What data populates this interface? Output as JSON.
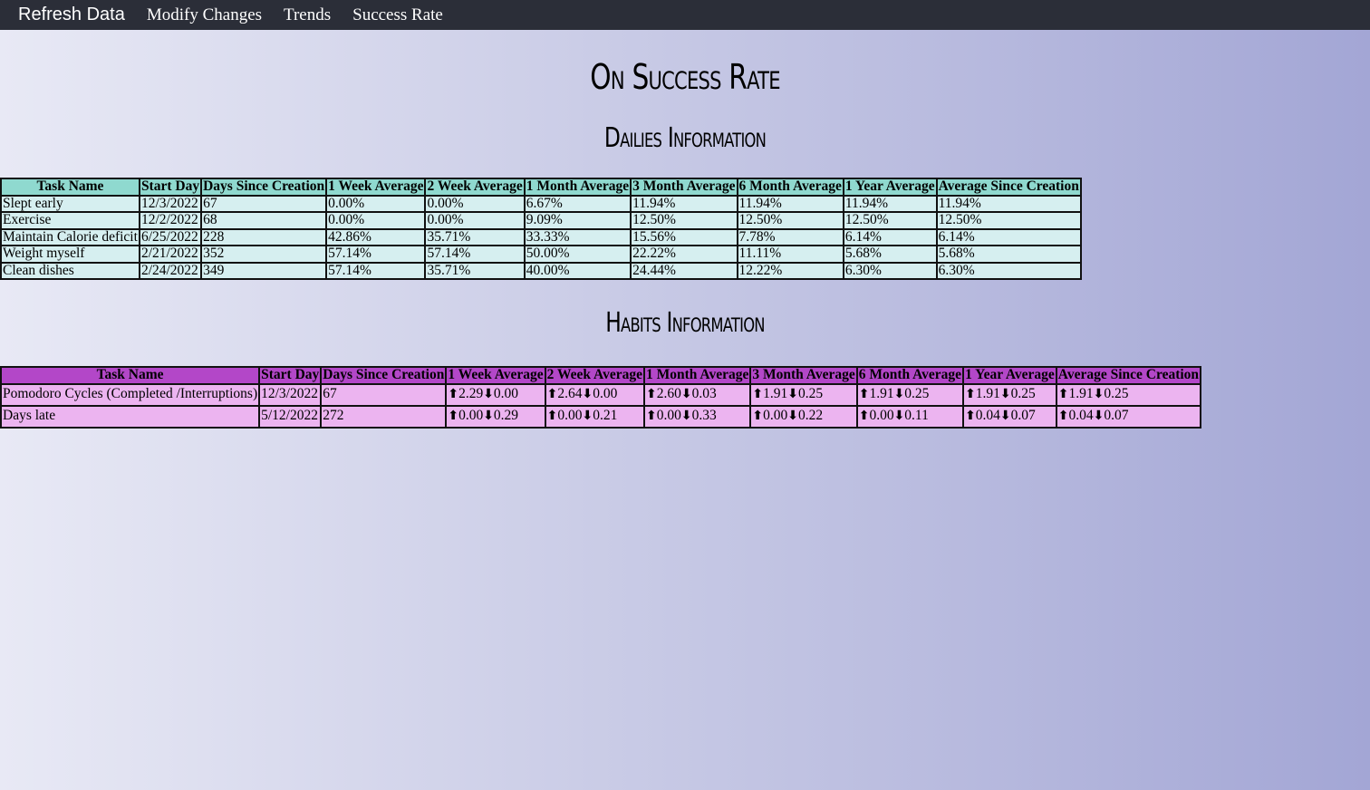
{
  "nav": {
    "brand": "Refresh Data",
    "links": [
      "Modify Changes",
      "Trends",
      "Success Rate"
    ]
  },
  "page_title": "On Success Rate",
  "dailies": {
    "title": "Dailies Information",
    "headers": [
      "Task Name",
      "Start Day",
      "Days Since Creation",
      "1 Week Average",
      "2 Week Average",
      "1 Month Average",
      "3 Month Average",
      "6 Month Average",
      "1 Year Average",
      "Average Since Creation"
    ],
    "rows": [
      [
        "Slept early",
        "12/3/2022",
        "67",
        "0.00%",
        "0.00%",
        "6.67%",
        "11.94%",
        "11.94%",
        "11.94%",
        "11.94%"
      ],
      [
        "Exercise",
        "12/2/2022",
        "68",
        "0.00%",
        "0.00%",
        "9.09%",
        "12.50%",
        "12.50%",
        "12.50%",
        "12.50%"
      ],
      [
        "Maintain Calorie deficit",
        "6/25/2022",
        "228",
        "42.86%",
        "35.71%",
        "33.33%",
        "15.56%",
        "7.78%",
        "6.14%",
        "6.14%"
      ],
      [
        "Weight myself",
        "2/21/2022",
        "352",
        "57.14%",
        "57.14%",
        "50.00%",
        "22.22%",
        "11.11%",
        "5.68%",
        "5.68%"
      ],
      [
        "Clean dishes",
        "2/24/2022",
        "349",
        "57.14%",
        "35.71%",
        "40.00%",
        "24.44%",
        "12.22%",
        "6.30%",
        "6.30%"
      ]
    ]
  },
  "habits": {
    "title": "Habits Information",
    "up_icon": "arrow-up-icon",
    "down_icon": "arrow-down-icon",
    "headers": [
      "Task Name",
      "Start Day",
      "Days Since Creation",
      "1 Week Average",
      "2 Week Average",
      "1 Month Average",
      "3 Month Average",
      "6 Month Average",
      "1 Year Average",
      "Average Since Creation"
    ],
    "rows": [
      {
        "name": "Pomodoro Cycles (Completed /Interruptions)",
        "start": "12/3/2022",
        "days": "67",
        "averages": [
          {
            "up": "2.29",
            "down": "0.00"
          },
          {
            "up": "2.64",
            "down": "0.00"
          },
          {
            "up": "2.60",
            "down": "0.03"
          },
          {
            "up": "1.91",
            "down": "0.25"
          },
          {
            "up": "1.91",
            "down": "0.25"
          },
          {
            "up": "1.91",
            "down": "0.25"
          },
          {
            "up": "1.91",
            "down": "0.25"
          }
        ]
      },
      {
        "name": "Days late",
        "start": "5/12/2022",
        "days": "272",
        "averages": [
          {
            "up": "0.00",
            "down": "0.29"
          },
          {
            "up": "0.00",
            "down": "0.21"
          },
          {
            "up": "0.00",
            "down": "0.33"
          },
          {
            "up": "0.00",
            "down": "0.22"
          },
          {
            "up": "0.00",
            "down": "0.11"
          },
          {
            "up": "0.04",
            "down": "0.07"
          },
          {
            "up": "0.04",
            "down": "0.07"
          }
        ]
      }
    ]
  }
}
